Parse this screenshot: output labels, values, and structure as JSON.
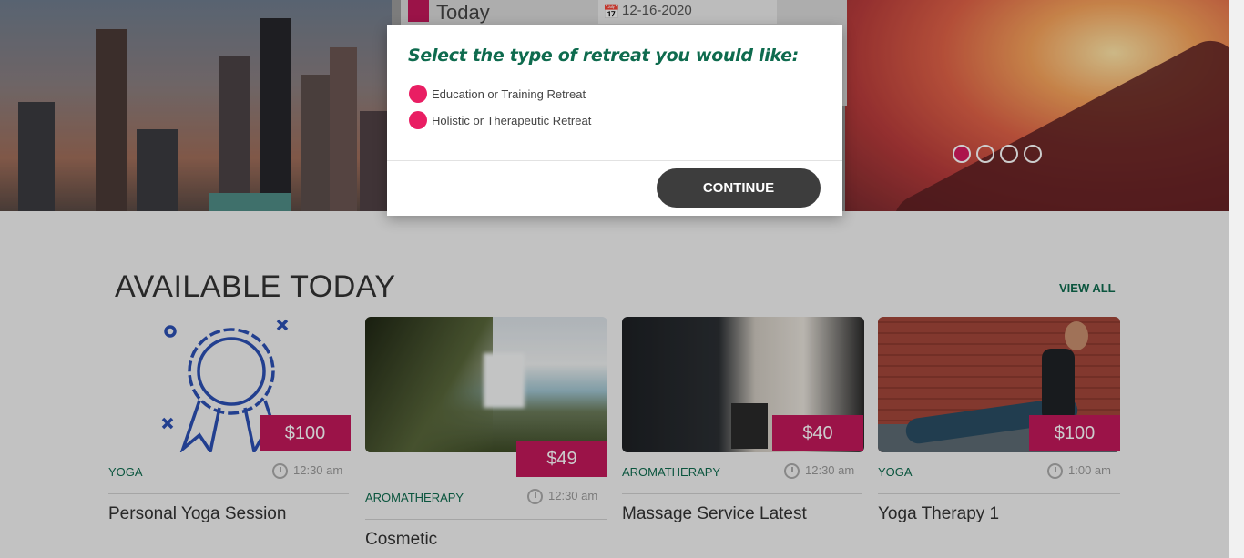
{
  "header_bar": {
    "today_label": "Today",
    "date_value": "12-16-2020"
  },
  "carousel": {
    "slides": 4,
    "active": 1
  },
  "section": {
    "title": "AVAILABLE TODAY",
    "view_all": "VIEW ALL"
  },
  "cards": [
    {
      "price": "$100",
      "category": "YOGA",
      "time": "12:30 am",
      "title": "Personal Yoga Session"
    },
    {
      "price": "$49",
      "category": "AROMATHERAPY",
      "time": "12:30 am",
      "title": "Cosmetic"
    },
    {
      "price": "$40",
      "category": "AROMATHERAPY",
      "time": "12:30 am",
      "title": "Massage Service Latest"
    },
    {
      "price": "$100",
      "category": "YOGA",
      "time": "1:00 am",
      "title": "Yoga Therapy 1"
    }
  ],
  "modal": {
    "question": "Select the type of retreat you would like:",
    "options": [
      {
        "label": "Education or Training Retreat"
      },
      {
        "label": "Holistic or Therapeutic Retreat"
      }
    ],
    "continue_label": "CONTINUE"
  },
  "colors": {
    "accent": "#c2185b",
    "radio": "#e91e63",
    "green": "#0e6b4e",
    "button": "#3d3d3d"
  }
}
